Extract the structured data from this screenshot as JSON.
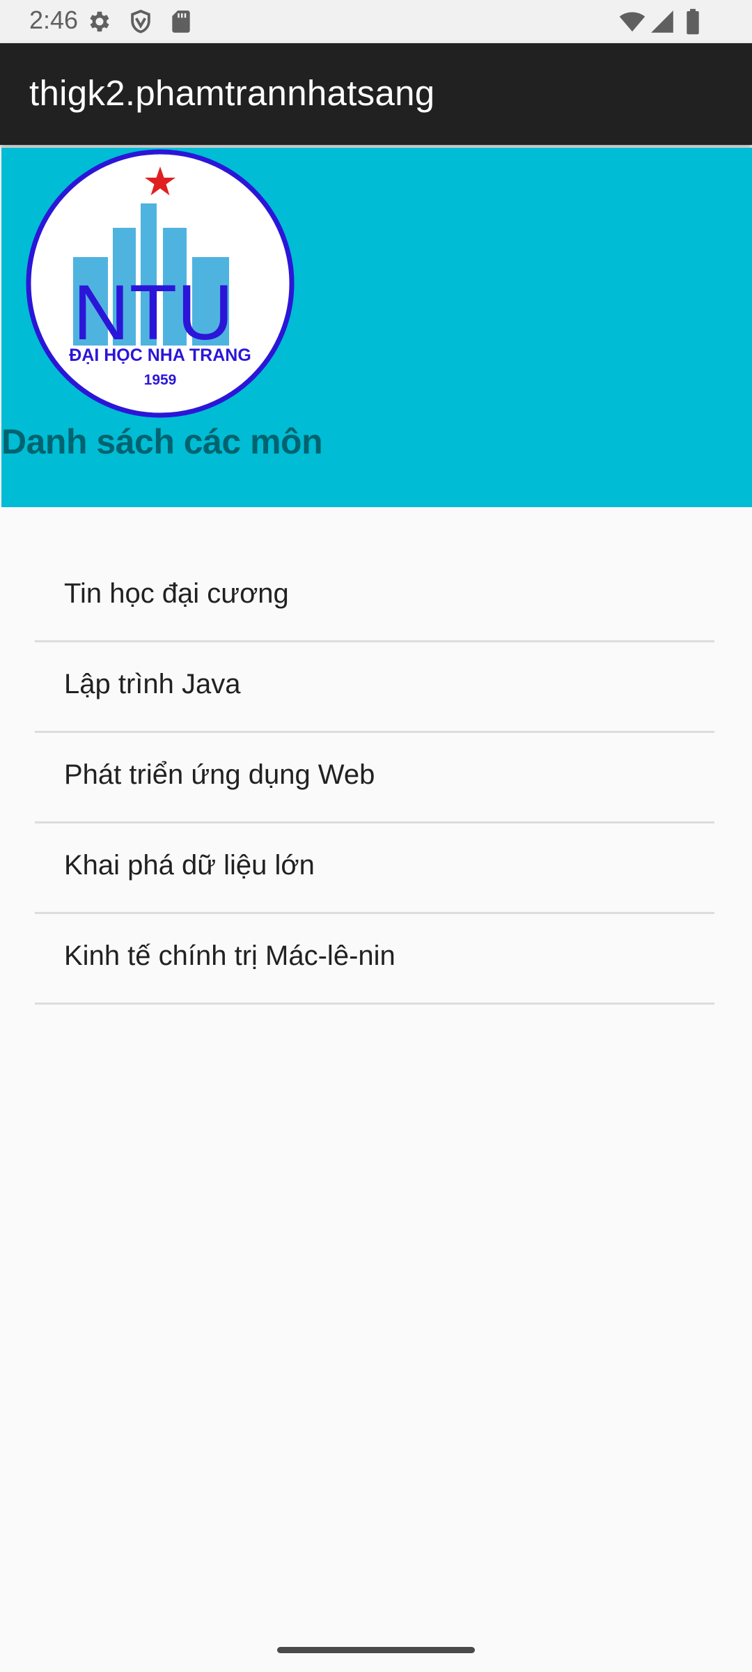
{
  "status_bar": {
    "time": "2:46",
    "icons_left": [
      "settings-gear",
      "shield",
      "sd-card"
    ],
    "icons_right": [
      "wifi",
      "cellular-signal",
      "battery"
    ]
  },
  "app_bar": {
    "title": "thigk2.phamtrannhatsang"
  },
  "header": {
    "logo": {
      "monogram": "NTU",
      "university_name": "ĐẠI HỌC NHA TRANG",
      "year": "1959"
    },
    "title": "Danh sách các môn"
  },
  "courses": [
    {
      "label": "Tin học đại cương"
    },
    {
      "label": "Lập trình Java"
    },
    {
      "label": "Phát triển ứng dụng Web"
    },
    {
      "label": "Khai phá dữ liệu lớn"
    },
    {
      "label": "Kinh tế chính trị Mác-lê-nin"
    }
  ],
  "colors": {
    "app_bar_bg": "#212121",
    "header_bg": "#00bcd4",
    "header_title": "#00636f",
    "logo_blue": "#2b16d8",
    "logo_bars": "#4fb3e0",
    "logo_star": "#e02020"
  }
}
